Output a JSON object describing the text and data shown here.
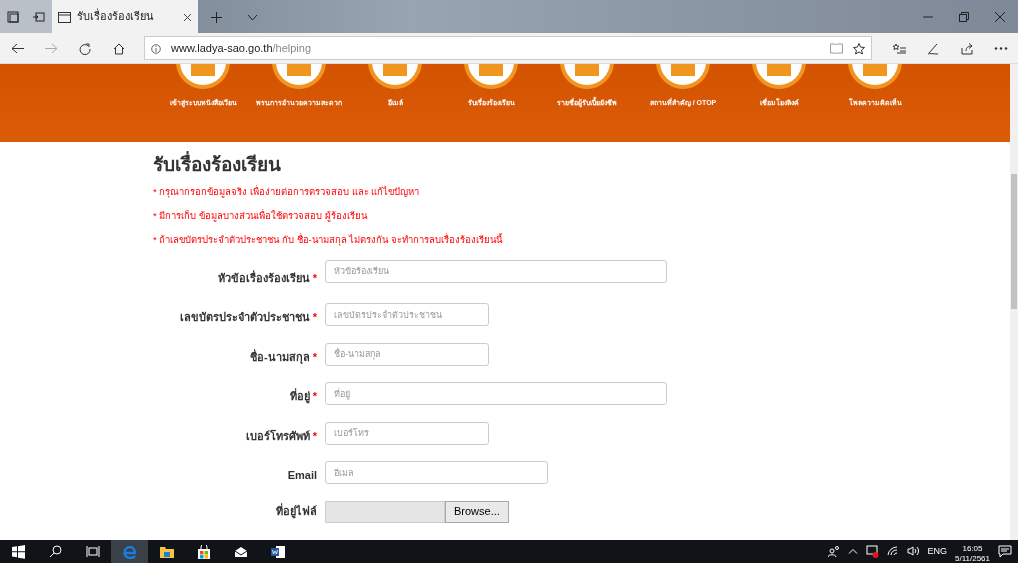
{
  "browser": {
    "tab_title": "รับเรื่องร้องเรียน",
    "address": {
      "host": "www.ladya-sao.go.th",
      "path": "/helping"
    }
  },
  "banner": {
    "items": [
      {
        "label": "เข้าสู่ระบบหนังสือเวียน"
      },
      {
        "label": "พรบ.การอำนวยความสะดวก"
      },
      {
        "label": "อีเมล์"
      },
      {
        "label": "รับเรื่องร้องเรียน"
      },
      {
        "label": "รายชื่อผู้รับเบี้ยยังชีพ"
      },
      {
        "label": "สถานที่สำคัญ / OTOP"
      },
      {
        "label": "เชื่อมโยงลิงค์"
      },
      {
        "label": "โพลความคิดเห็น"
      }
    ]
  },
  "page": {
    "title": "รับเรื่องร้องเรียน",
    "required_mark": "*",
    "notes": [
      "* กรุณากรอกข้อมูลจริง เพื่อง่ายต่อการตรวจสอบ และ แก้ไขปัญหา",
      "* มีการเก็บ ข้อมูลบางส่วนเพื่อใช้ตรวจสอบ ผู้ร้องเรียน",
      "* ถ้าเลขบัตรประจำตัวประชาชน กับ ชื่อ-นามสกุล ไม่ตรงกัน จะทำการลบเรื่องร้องเรียนนี้"
    ],
    "fields": [
      {
        "kind": "text",
        "label": "หัวข้อเรื่องร้องเรียน",
        "required": true,
        "placeholder": "หัวข้อร้องเรียน"
      },
      {
        "kind": "text",
        "label": "เลขบัตรประจำตัวประชาชน",
        "required": true,
        "placeholder": "เลขบัตรประจำตัวประชาชน"
      },
      {
        "kind": "text",
        "label": "ชื่อ-นามสกุล",
        "required": true,
        "placeholder": "ชื่อ-นามสกุล"
      },
      {
        "kind": "text",
        "label": "ที่อยู่",
        "required": true,
        "placeholder": "ที่อยู่"
      },
      {
        "kind": "text",
        "label": "เบอร์โทรศัพท์",
        "required": true,
        "placeholder": "เบอร์โทร"
      },
      {
        "kind": "text",
        "label": "Email",
        "required": false,
        "placeholder": "อีเมล"
      },
      {
        "kind": "file",
        "label": "ที่อยู่ไฟล์",
        "required": false,
        "button": "Browse..."
      }
    ]
  },
  "tray": {
    "language": "ENG",
    "time": "16:05",
    "date": "5/11/2561"
  }
}
